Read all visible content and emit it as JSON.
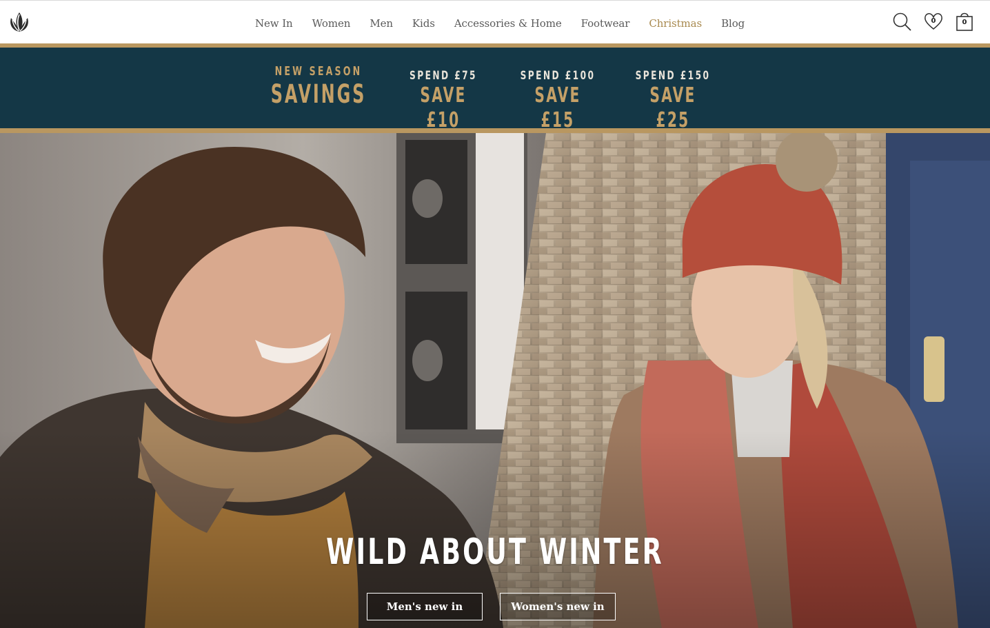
{
  "header": {
    "logo_icon": "leaf-logo-icon",
    "nav": [
      "New In",
      "Women",
      "Men",
      "Kids",
      "Accessories & Home",
      "Footwear",
      "Christmas",
      "Blog"
    ],
    "accent_nav_index": 6,
    "accent_color": "#a8894e",
    "wishlist_count": "0",
    "bag_count": "0",
    "icons": [
      "search-icon",
      "heart-icon",
      "bag-icon"
    ]
  },
  "promo": {
    "headline_small": "NEW SEASON",
    "headline_big": "SAVINGS",
    "offers": [
      {
        "spend": "SPEND £75",
        "save": "SAVE £10"
      },
      {
        "spend": "SPEND £100",
        "save": "SAVE £15"
      },
      {
        "spend": "SPEND £150",
        "save": "SAVE £25"
      }
    ],
    "background": "#143746",
    "gold": "#c4a067"
  },
  "hero": {
    "title": "WILD ABOUT WINTER",
    "buttons": [
      "Men's new in",
      "Women's new in"
    ]
  }
}
